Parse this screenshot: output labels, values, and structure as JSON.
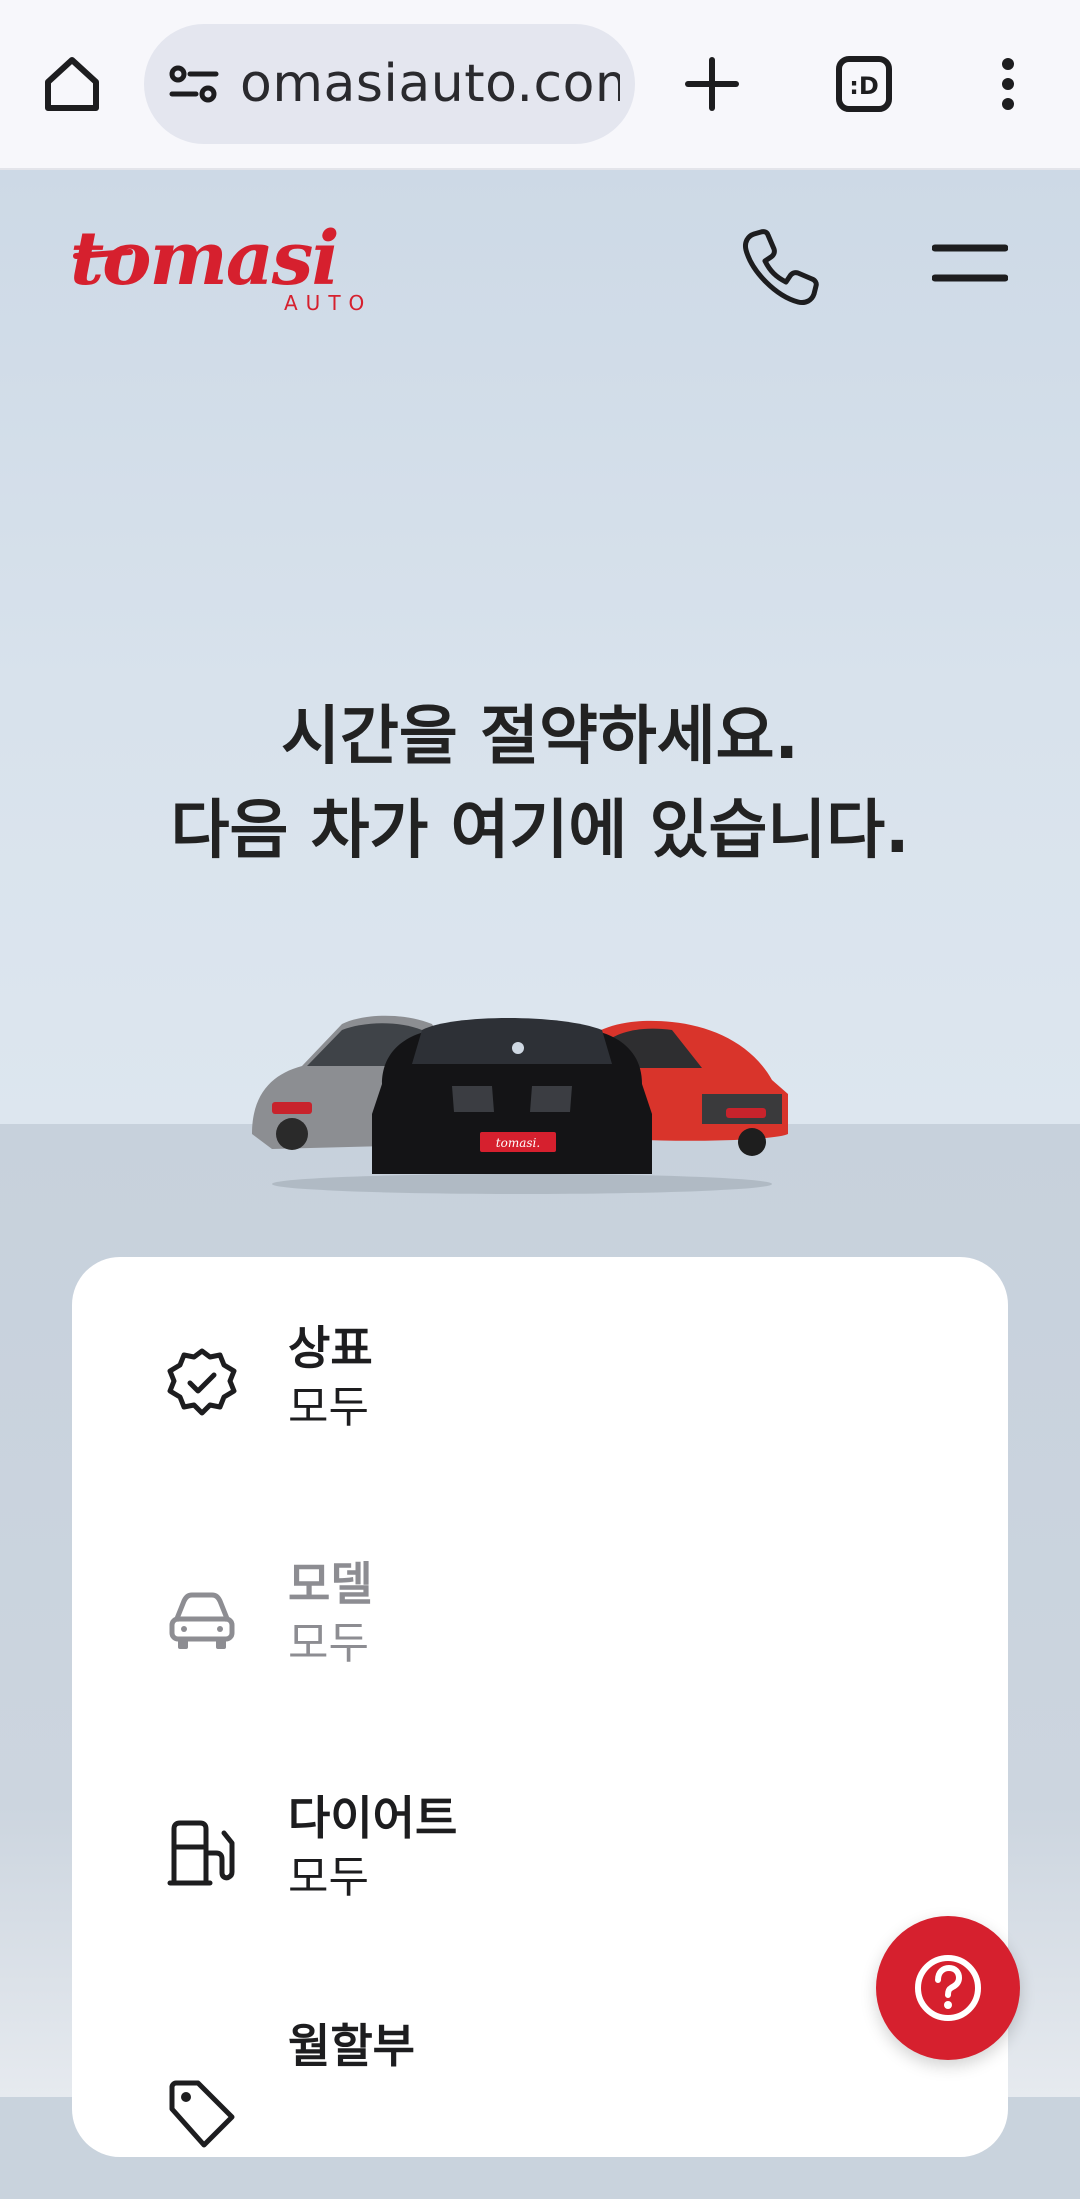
{
  "browser": {
    "url": "omasiauto.com",
    "icons": [
      "home-icon",
      "site-settings-icon",
      "new-tab-icon",
      "tab-switcher-icon",
      "more-menu-icon"
    ],
    "tab_badge": ":D"
  },
  "site": {
    "brand_accent": "#d6202e",
    "logo_alt": "tomasi AUTO",
    "headline_line1": "시간을 절약하세요.",
    "headline_line2": "다음 차가 여기에 있습니다.",
    "plate_text": "tomasi."
  },
  "filters": [
    {
      "label": "상표",
      "value": "모두",
      "icon": "badge-check-icon",
      "enabled": true
    },
    {
      "label": "모델",
      "value": "모두",
      "icon": "car-icon",
      "enabled": false
    },
    {
      "label": "다이어트",
      "value": "모두",
      "icon": "fuel-pump-icon",
      "enabled": true
    },
    {
      "label": "월할부",
      "value": "",
      "icon": "price-tag-icon",
      "enabled": true
    }
  ]
}
